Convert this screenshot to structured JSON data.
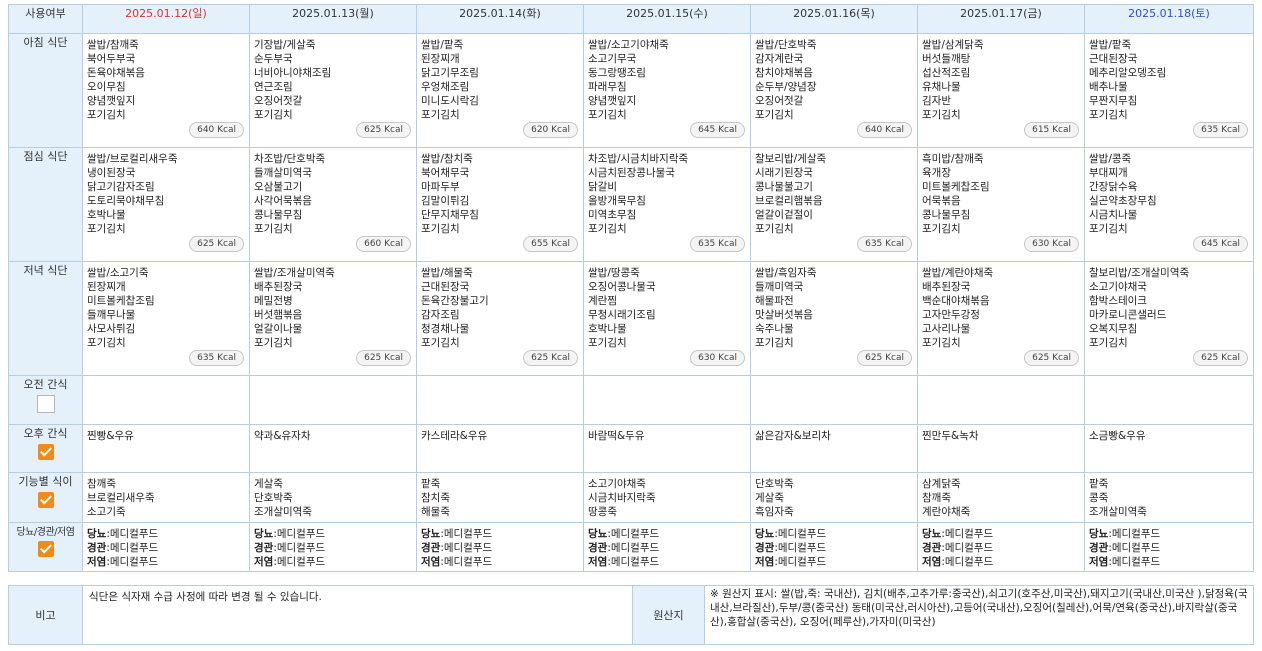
{
  "header": {
    "corner": "사용여부",
    "days": [
      "2025.01.12(일)",
      "2025.01.13(월)",
      "2025.01.14(화)",
      "2025.01.15(수)",
      "2025.01.16(목)",
      "2025.01.17(금)",
      "2025.01.18(토)"
    ]
  },
  "rows": {
    "breakfast": "아침 식단",
    "lunch": "점심 식단",
    "dinner": "저녁 식단",
    "am_snack": "오전 간식",
    "pm_snack": "오후 간식",
    "functional": "기능별 식이",
    "special": "당뇨/경관/저염"
  },
  "checkboxes": {
    "am_snack": false,
    "pm_snack": true,
    "functional": true,
    "special": true
  },
  "breakfast": [
    {
      "items": "쌀밥/참깨죽\n북어두부국\n돈육야채볶음\n오이무침\n양념깻잎지\n포기김치",
      "kcal": "640 Kcal"
    },
    {
      "items": "기장밥/게살죽\n순두부국\n너비아니야채조림\n연근조림\n오징어젓갈\n포기김치",
      "kcal": "625 Kcal"
    },
    {
      "items": "쌀밥/팥죽\n된장찌개\n닭고기무조림\n우엉채조림\n미니도시락김\n포기김치",
      "kcal": "620 Kcal"
    },
    {
      "items": "쌀밥/소고기야채죽\n소고기무국\n동그랑땡조림\n파래무침\n양념깻잎지\n포기김치",
      "kcal": "645 Kcal"
    },
    {
      "items": "쌀밥/단호박죽\n감자계란국\n참치야채볶음\n순두부/양념장\n오징어젓갈\n포기김치",
      "kcal": "640 Kcal"
    },
    {
      "items": "쌀밥/삼계닭죽\n버섯들깨탕\n섭산적조림\n유채나물\n김자반\n포기김치",
      "kcal": "615 Kcal"
    },
    {
      "items": "쌀밥/팥죽\n근대된장국\n메추리알오뎅조림\n배추나물\n무짠지무침\n포기김치",
      "kcal": "635 Kcal"
    }
  ],
  "lunch": [
    {
      "items": "쌀밥/브로컬리새우죽\n냉이된장국\n닭고기감자조림\n도토리묵야채무침\n호박나물\n포기김치",
      "kcal": "625 Kcal"
    },
    {
      "items": "차조밥/단호박죽\n들깨살미역국\n오삼불고기\n사각어묵볶음\n콩나물무침\n포기김치",
      "kcal": "660 Kcal"
    },
    {
      "items": "쌀밥/참치죽\n북어채무국\n마파두부\n김말이튀김\n단무지채무침\n포기김치",
      "kcal": "655 Kcal"
    },
    {
      "items": "차조밥/시금치바지락죽\n시금치된장콩나물국\n닭갈비\n올방개묵무침\n미역초무침\n포기김치",
      "kcal": "635 Kcal"
    },
    {
      "items": "찰보리밥/게살죽\n시래기된장국\n콩나물불고기\n브로컬리햄볶음\n얼갈이겉절이\n포기김치",
      "kcal": "635 Kcal"
    },
    {
      "items": "흑미밥/참깨죽\n육개장\n미트볼케찹조림\n어묵볶음\n콩나물무침\n포기김치",
      "kcal": "630 Kcal"
    },
    {
      "items": "쌀밥/콩죽\n부대찌개\n간장닭수육\n실곤약초장무침\n시금치나물\n포기김치",
      "kcal": "645 Kcal"
    }
  ],
  "dinner": [
    {
      "items": "쌀밥/소고기죽\n된장찌개\n미트볼케찹조림\n들깨무나물\n사모사튀김\n포기김치",
      "kcal": "635 Kcal"
    },
    {
      "items": "쌀밥/조개살미역죽\n배추된장국\n메밀전병\n버섯햄볶음\n얼갈이나물\n포기김치",
      "kcal": "625 Kcal"
    },
    {
      "items": "쌀밥/해물죽\n근대된장국\n돈육간장불고기\n감자조림\n청경채나물\n포기김치",
      "kcal": "625 Kcal"
    },
    {
      "items": "쌀밥/땅콩죽\n오징어콩나물국\n계란찜\n무청시래기조림\n호박나물\n포기김치",
      "kcal": "630 Kcal"
    },
    {
      "items": "쌀밥/흑임자죽\n들깨미역국\n해물파전\n맛살버섯볶음\n숙주나물\n포기김치",
      "kcal": "625 Kcal"
    },
    {
      "items": "쌀밥/계란야채죽\n배추된장국\n백순대야채볶음\n고자만두강정\n고사리나물\n포기김치",
      "kcal": "625 Kcal"
    },
    {
      "items": "찰보리밥/조개살미역죽\n소고기야채국\n함박스테이크\n마카로니콘샐러드\n오복지무침\n포기김치",
      "kcal": "625 Kcal"
    }
  ],
  "am_snack": [
    "",
    "",
    "",
    "",
    "",
    "",
    ""
  ],
  "pm_snack": [
    "찐빵&우유",
    "약과&유자차",
    "카스테라&우유",
    "바람떡&두유",
    "삶은감자&보리차",
    "찐만두&녹차",
    "소금빵&우유"
  ],
  "functional": [
    "참깨죽\n브로컬리새우죽\n소고기죽",
    "게살죽\n단호박죽\n조개살미역죽",
    "팥죽\n참치죽\n해물죽",
    "소고기야채죽\n시금치바지락죽\n땅콩죽",
    "단호박죽\n게살죽\n흑임자죽",
    "삼계닭죽\n참깨죽\n계란야채죽",
    "팥죽\n콩죽\n조개살미역죽"
  ],
  "special": {
    "labels": [
      "당뇨",
      "경관",
      "저염"
    ],
    "value": ":메디컬푸드"
  },
  "note": {
    "label": "비고",
    "text": "식단은 식자재 수급 사정에 따라 변경 될 수 있습니다.",
    "origin_label": "원산지",
    "origin_text": "※ 원산지 표시: 쌀(밥,죽: 국내산), 김치(배추,고추가루:중국산),쇠고기(호주산,미국산),돼지고기(국내산,미국산 ),닭정육(국내산,브라질산),두부/콩(중국산) 동태(미국산,러시아산),고등어(국내산),오징어(칠레산),어묵/연육(중국산),바지락살(중국산),홍합살(중국산), 오징어(페루산),가자미(미국산)"
  }
}
